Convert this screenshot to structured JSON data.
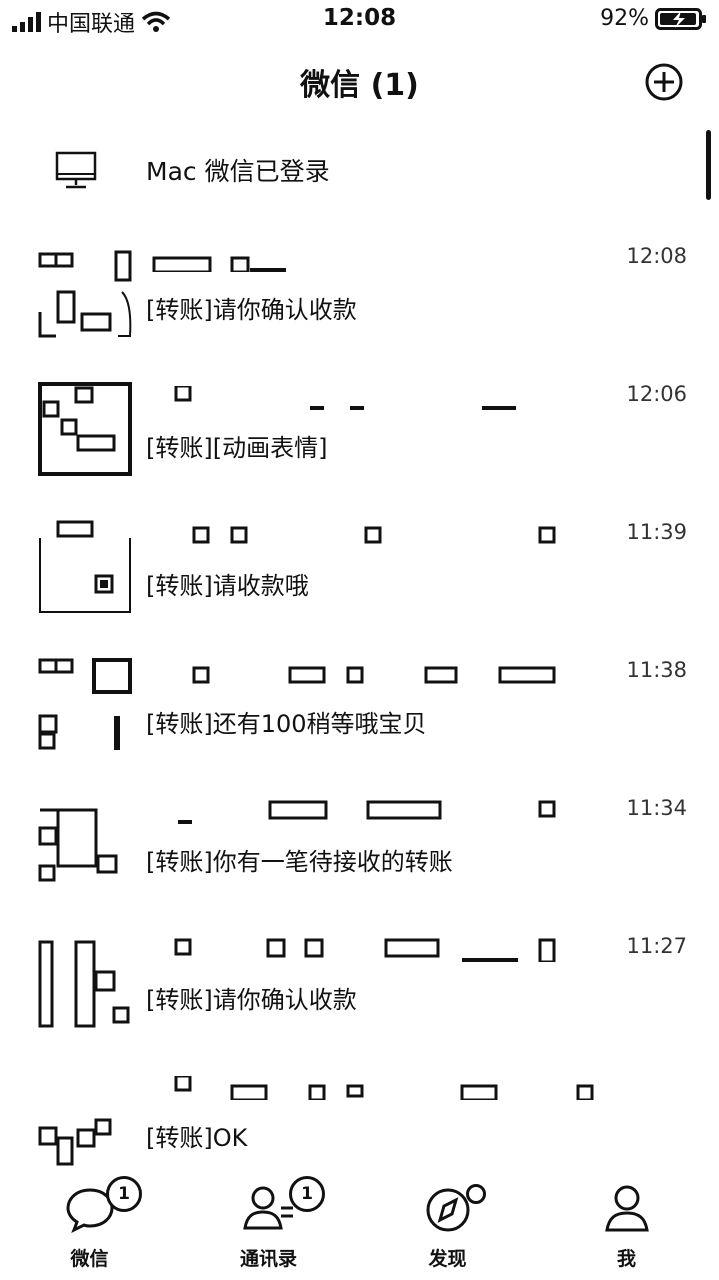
{
  "status_bar": {
    "carrier": "中国联通",
    "time": "12:08",
    "battery": "92%"
  },
  "header": {
    "title": "微信 (1)"
  },
  "mac_login": {
    "text": "Mac 微信已登录",
    "icon": "monitor-icon"
  },
  "chats": [
    {
      "time": "12:08",
      "preview": "[转账]请你确认收款"
    },
    {
      "time": "12:06",
      "preview": "[转账][动画表情]"
    },
    {
      "time": "11:39",
      "preview": "[转账]请收款哦"
    },
    {
      "time": "11:38",
      "preview": "[转账]还有100稍等哦宝贝"
    },
    {
      "time": "11:34",
      "preview": "[转账]你有一笔待接收的转账"
    },
    {
      "time": "11:27",
      "preview": "[转账]请你确认收款"
    },
    {
      "time": "",
      "preview": "[转账]OK"
    }
  ],
  "tabs": [
    {
      "label": "微信",
      "badge": "1",
      "icon": "chat-bubble-icon"
    },
    {
      "label": "通讯录",
      "badge": "1",
      "icon": "contacts-icon"
    },
    {
      "label": "发现",
      "icon": "compass-icon"
    },
    {
      "label": "我",
      "icon": "person-icon"
    }
  ]
}
